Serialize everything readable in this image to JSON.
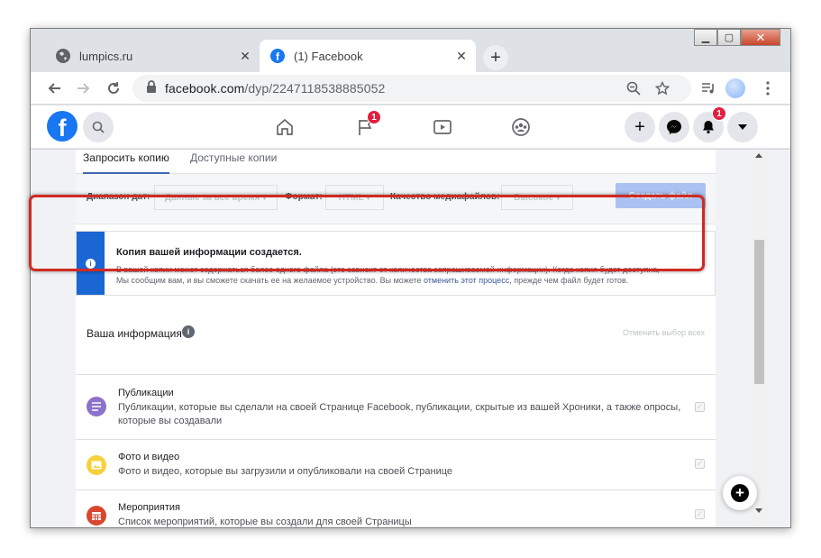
{
  "browser": {
    "tabs": [
      {
        "title": "lumpics.ru",
        "close": "✕"
      },
      {
        "title": "(1) Facebook",
        "close": "✕"
      }
    ],
    "new_tab": "+",
    "address": {
      "host": "facebook.com",
      "path": "/dyp/2247118538885052"
    }
  },
  "window_controls": {
    "minimize": "▁",
    "maximize": "▢",
    "close": "✕"
  },
  "fb_header": {
    "logo": "f",
    "pages_badge": "1",
    "notifications_badge": "1",
    "create": "+"
  },
  "download_panel": {
    "tabs": [
      "Запросить копию",
      "Доступные копии"
    ],
    "filters": {
      "date_label": "Диапазон дат:",
      "date_value": "Данные за все время ▾",
      "format_label": "Формат:",
      "format_value": "HTML ▾",
      "quality_label": "Качество медиафайлов:",
      "quality_value": "Высокое ▾",
      "create_button": "Создать файл"
    },
    "alert": {
      "icon": "i",
      "title": "Копия вашей информации создается.",
      "body_line1": "В вашей копии может содержаться более одного файла (это зависит от количества запрашиваемой информации). Когда копия будет доступна,",
      "body_line2_start": "Мы сообщим вам, и вы сможете скачать ее на желаемое устройство. Вы можете ",
      "body_link": "отменить этот процесс",
      "body_line2_end": ", прежде чем файл будет готов."
    },
    "your_info": {
      "label": "Ваша информация",
      "icon": "i",
      "deselect_all": "Отменить выбор всех"
    },
    "items": [
      {
        "title": "Публикации",
        "desc": "Публикации, которые вы сделали на своей Странице Facebook, публикации, скрытые из вашей Хроники, а также опросы, которые вы создавали",
        "checked": "✓",
        "color": "#8c72cb"
      },
      {
        "title": "Фото и видео",
        "desc": "Фото и видео, которые вы загрузили и опубликовали на своей Странице",
        "checked": "✓",
        "color": "#f7d13c"
      },
      {
        "title": "Мероприятия",
        "desc": "Список мероприятий, которые вы создали для своей Страницы",
        "checked": "✓",
        "color": "#d7472e"
      }
    ]
  },
  "fab": {
    "label": "+"
  }
}
